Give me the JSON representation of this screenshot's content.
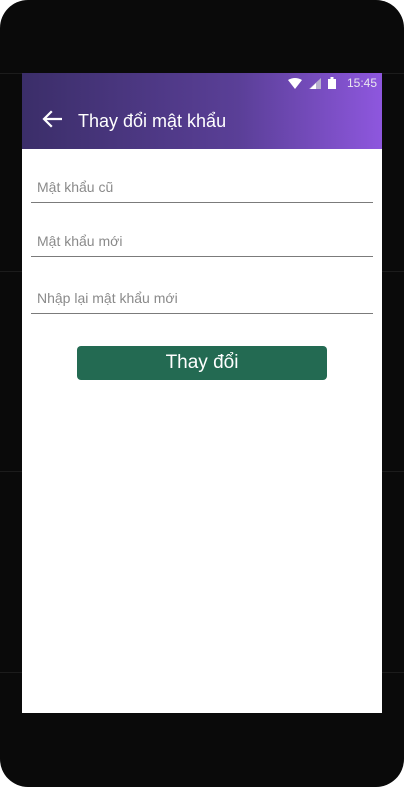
{
  "status_bar": {
    "time": "15:45",
    "icons": [
      "wifi-icon",
      "signal-icon",
      "battery-icon"
    ]
  },
  "toolbar": {
    "back_icon": "arrow-left-icon",
    "title": "Thay đổi mật khẩu"
  },
  "form": {
    "old_password": {
      "placeholder": "Mật khẩu cũ",
      "value": ""
    },
    "new_password": {
      "placeholder": "Mật khẩu mới",
      "value": ""
    },
    "confirm_password": {
      "placeholder": "Nhập lại mật khẩu mới",
      "value": ""
    }
  },
  "submit_button": {
    "label": "Thay đổi"
  },
  "colors": {
    "appbar_gradient_start": "#3b2e69",
    "appbar_gradient_end": "#8e57de",
    "button": "#236a52"
  }
}
